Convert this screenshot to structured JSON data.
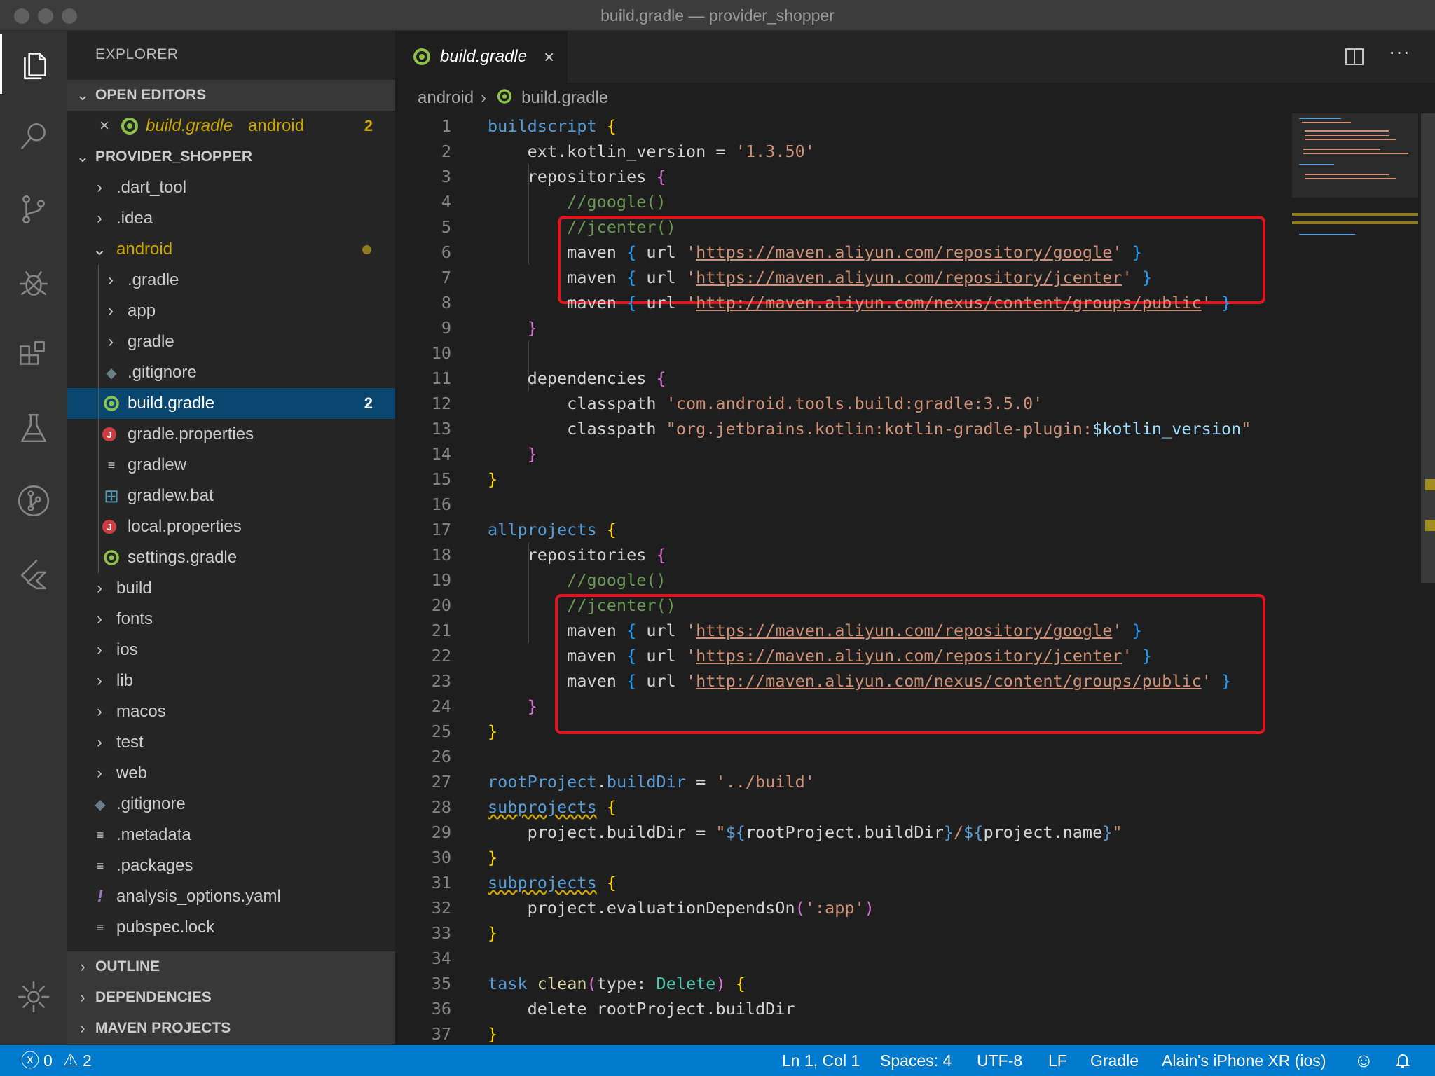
{
  "window": {
    "title": "build.gradle — provider_shopper"
  },
  "sidebar": {
    "title": "EXPLORER",
    "open_editors": {
      "label": "OPEN EDITORS",
      "items": [
        {
          "name": "build.gradle",
          "folder": "android",
          "badge": "2"
        }
      ]
    },
    "project": {
      "label": "PROVIDER_SHOPPER"
    },
    "tree": [
      {
        "name": ".dart_tool",
        "type": "folder",
        "depth": 0,
        "expanded": false
      },
      {
        "name": ".idea",
        "type": "folder",
        "depth": 0,
        "expanded": false
      },
      {
        "name": "android",
        "type": "folder",
        "depth": 0,
        "expanded": true,
        "modified": true
      },
      {
        "name": ".gradle",
        "type": "folder",
        "depth": 1,
        "expanded": false
      },
      {
        "name": "app",
        "type": "folder",
        "depth": 1,
        "expanded": false
      },
      {
        "name": "gradle",
        "type": "folder",
        "depth": 1,
        "expanded": false
      },
      {
        "name": ".gitignore",
        "type": "git",
        "depth": 1
      },
      {
        "name": "build.gradle",
        "type": "gradle",
        "depth": 1,
        "selected": true,
        "badge": "2"
      },
      {
        "name": "gradle.properties",
        "type": "java-props",
        "depth": 1
      },
      {
        "name": "gradlew",
        "type": "text",
        "depth": 1
      },
      {
        "name": "gradlew.bat",
        "type": "windows",
        "depth": 1
      },
      {
        "name": "local.properties",
        "type": "java-props",
        "depth": 1
      },
      {
        "name": "settings.gradle",
        "type": "gradle",
        "depth": 1
      },
      {
        "name": "build",
        "type": "folder",
        "depth": 0,
        "expanded": false
      },
      {
        "name": "fonts",
        "type": "folder",
        "depth": 0,
        "expanded": false
      },
      {
        "name": "ios",
        "type": "folder",
        "depth": 0,
        "expanded": false
      },
      {
        "name": "lib",
        "type": "folder",
        "depth": 0,
        "expanded": false
      },
      {
        "name": "macos",
        "type": "folder",
        "depth": 0,
        "expanded": false
      },
      {
        "name": "test",
        "type": "folder",
        "depth": 0,
        "expanded": false
      },
      {
        "name": "web",
        "type": "folder",
        "depth": 0,
        "expanded": false
      },
      {
        "name": ".gitignore",
        "type": "git",
        "depth": 0
      },
      {
        "name": ".metadata",
        "type": "text",
        "depth": 0
      },
      {
        "name": ".packages",
        "type": "text",
        "depth": 0
      },
      {
        "name": "analysis_options.yaml",
        "type": "yaml",
        "depth": 0
      },
      {
        "name": "pubspec.lock",
        "type": "text",
        "depth": 0
      }
    ],
    "bottom_sections": [
      "OUTLINE",
      "DEPENDENCIES",
      "MAVEN PROJECTS"
    ]
  },
  "editor": {
    "tab": {
      "label": "build.gradle",
      "close": "×"
    },
    "breadcrumbs": [
      "android",
      "build.gradle"
    ],
    "lines": [
      [
        [
          "k",
          "buildscript"
        ],
        [
          "p",
          " "
        ],
        [
          "b1",
          "{"
        ]
      ],
      [
        [
          "p",
          "    ext.kotlin_version = "
        ],
        [
          "s",
          "'1.3.50'"
        ]
      ],
      [
        [
          "p",
          "    repositories "
        ],
        [
          "b2",
          "{"
        ]
      ],
      [
        [
          "c",
          "        //google()"
        ]
      ],
      [
        [
          "c",
          "        //jcenter()"
        ]
      ],
      [
        [
          "p",
          "        maven "
        ],
        [
          "b3",
          "{"
        ],
        [
          "p",
          " url "
        ],
        [
          "s",
          "'"
        ],
        [
          "su",
          "https://maven.aliyun.com/repository/google"
        ],
        [
          "s",
          "'"
        ],
        [
          "p",
          " "
        ],
        [
          "b3",
          "}"
        ]
      ],
      [
        [
          "p",
          "        maven "
        ],
        [
          "b3",
          "{"
        ],
        [
          "p",
          " url "
        ],
        [
          "s",
          "'"
        ],
        [
          "su",
          "https://maven.aliyun.com/repository/jcenter"
        ],
        [
          "s",
          "'"
        ],
        [
          "p",
          " "
        ],
        [
          "b3",
          "}"
        ]
      ],
      [
        [
          "p",
          "        maven "
        ],
        [
          "b3",
          "{"
        ],
        [
          "p",
          " url "
        ],
        [
          "s",
          "'"
        ],
        [
          "su",
          "http://maven.aliyun.com/nexus/content/groups/public"
        ],
        [
          "s",
          "'"
        ],
        [
          "p",
          " "
        ],
        [
          "b3",
          "}"
        ]
      ],
      [
        [
          "p",
          "    "
        ],
        [
          "b2",
          "}"
        ]
      ],
      [
        [
          "p",
          ""
        ]
      ],
      [
        [
          "p",
          "    dependencies "
        ],
        [
          "b2",
          "{"
        ]
      ],
      [
        [
          "p",
          "        classpath "
        ],
        [
          "s",
          "'com.android.tools.build:gradle:3.5.0'"
        ]
      ],
      [
        [
          "p",
          "        classpath "
        ],
        [
          "s",
          "\"org.jetbrains.kotlin:kotlin-gradle-plugin:"
        ],
        [
          "v",
          "$kotlin_version"
        ],
        [
          "s",
          "\""
        ]
      ],
      [
        [
          "p",
          "    "
        ],
        [
          "b2",
          "}"
        ]
      ],
      [
        [
          "b1",
          "}"
        ]
      ],
      [
        [
          "p",
          ""
        ]
      ],
      [
        [
          "k",
          "allprojects"
        ],
        [
          "p",
          " "
        ],
        [
          "b1",
          "{"
        ]
      ],
      [
        [
          "p",
          "    repositories "
        ],
        [
          "b2",
          "{"
        ]
      ],
      [
        [
          "c",
          "        //google()"
        ]
      ],
      [
        [
          "c",
          "        //jcenter()"
        ]
      ],
      [
        [
          "p",
          "        maven "
        ],
        [
          "b3",
          "{"
        ],
        [
          "p",
          " url "
        ],
        [
          "s",
          "'"
        ],
        [
          "su",
          "https://maven.aliyun.com/repository/google"
        ],
        [
          "s",
          "'"
        ],
        [
          "p",
          " "
        ],
        [
          "b3",
          "}"
        ]
      ],
      [
        [
          "p",
          "        maven "
        ],
        [
          "b3",
          "{"
        ],
        [
          "p",
          " url "
        ],
        [
          "s",
          "'"
        ],
        [
          "su",
          "https://maven.aliyun.com/repository/jcenter"
        ],
        [
          "s",
          "'"
        ],
        [
          "p",
          " "
        ],
        [
          "b3",
          "}"
        ]
      ],
      [
        [
          "p",
          "        maven "
        ],
        [
          "b3",
          "{"
        ],
        [
          "p",
          " url "
        ],
        [
          "s",
          "'"
        ],
        [
          "su",
          "http://maven.aliyun.com/nexus/content/groups/public"
        ],
        [
          "s",
          "'"
        ],
        [
          "p",
          " "
        ],
        [
          "b3",
          "}"
        ]
      ],
      [
        [
          "p",
          "    "
        ],
        [
          "b2",
          "}"
        ]
      ],
      [
        [
          "b1",
          "}"
        ]
      ],
      [
        [
          "p",
          ""
        ]
      ],
      [
        [
          "k",
          "rootProject"
        ],
        [
          "p",
          "."
        ],
        [
          "k",
          "buildDir"
        ],
        [
          "p",
          " = "
        ],
        [
          "s",
          "'../build'"
        ]
      ],
      [
        [
          "ksq",
          "subprojects"
        ],
        [
          "p",
          " "
        ],
        [
          "b1",
          "{"
        ]
      ],
      [
        [
          "p",
          "    project.buildDir = "
        ],
        [
          "s",
          "\""
        ],
        [
          "k",
          "${"
        ],
        [
          "p",
          "rootProject.buildDir"
        ],
        [
          "k",
          "}"
        ],
        [
          "s",
          "/"
        ],
        [
          "k",
          "${"
        ],
        [
          "p",
          "project.name"
        ],
        [
          "k",
          "}"
        ],
        [
          "s",
          "\""
        ]
      ],
      [
        [
          "b1",
          "}"
        ]
      ],
      [
        [
          "ksq",
          "subprojects"
        ],
        [
          "p",
          " "
        ],
        [
          "b1",
          "{"
        ]
      ],
      [
        [
          "p",
          "    project.evaluationDependsOn"
        ],
        [
          "b2",
          "("
        ],
        [
          "s",
          "':app'"
        ],
        [
          "b2",
          ")"
        ]
      ],
      [
        [
          "b1",
          "}"
        ]
      ],
      [
        [
          "p",
          ""
        ]
      ],
      [
        [
          "k",
          "task"
        ],
        [
          "p",
          " "
        ],
        [
          "f",
          "clean"
        ],
        [
          "b2",
          "("
        ],
        [
          "p",
          "type: "
        ],
        [
          "t",
          "Delete"
        ],
        [
          "b2",
          ")"
        ],
        [
          "p",
          " "
        ],
        [
          "b1",
          "{"
        ]
      ],
      [
        [
          "p",
          "    delete rootProject.buildDir"
        ]
      ],
      [
        [
          "b1",
          "}"
        ]
      ]
    ]
  },
  "statusbar": {
    "errors": "0",
    "warnings": "2",
    "position": "Ln 1, Col 1",
    "spaces": "Spaces: 4",
    "encoding": "UTF-8",
    "eol": "LF",
    "language": "Gradle",
    "device": "Alain's iPhone XR (ios)"
  },
  "colors": {
    "activity_bar": "#333333",
    "sidebar": "#252526",
    "editor": "#1e1e1e",
    "status_bar": "#007acc",
    "selection": "#094771",
    "highlight_box": "#e0151f"
  },
  "icons": {
    "activity": [
      "files-icon",
      "search-icon",
      "source-control-icon",
      "debug-icon",
      "extensions-icon",
      "testing-icon",
      "git-graph-icon",
      "flutter-icon"
    ],
    "manage": "gear-icon"
  }
}
